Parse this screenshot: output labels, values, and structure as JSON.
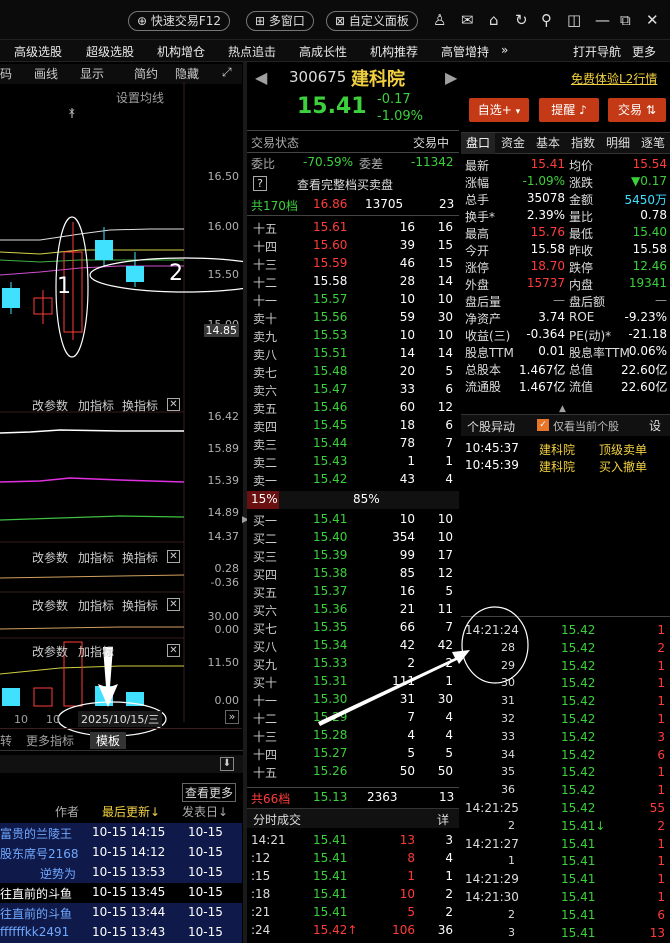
{
  "titlebar": {
    "quick_trade": "快速交易F12",
    "multi_window": "多窗口",
    "custom_panel": "自定义面板"
  },
  "menu": [
    "高级选股",
    "超级选股",
    "机构增仓",
    "热点追击",
    "高成长性",
    "机构推荐",
    "高管增持",
    "»",
    "打开导航",
    "更多"
  ],
  "chart": {
    "toolbar": [
      "码",
      "画线",
      "显示",
      "简约",
      "隐藏"
    ],
    "setting": "设置均线",
    "price_ticks": [
      "16.50",
      "16.00",
      "15.50",
      "15.00",
      "14.85"
    ],
    "annotations": [
      "1",
      "2"
    ],
    "panel1": {
      "labels": [
        "改参数",
        "加指标",
        "换指标"
      ],
      "ticks": [
        "16.42",
        "15.89",
        "15.39",
        "14.89",
        "14.37"
      ]
    },
    "panel2": {
      "labels": [
        "改参数",
        "加指标",
        "换指标"
      ],
      "ticks": [
        "0.28",
        "-0.36"
      ]
    },
    "panel3": {
      "labels": [
        "改参数",
        "加指标",
        "换指标"
      ],
      "ticks": [
        "30.00",
        "0.00"
      ]
    },
    "panel4": {
      "labels": [
        "改参数",
        "加指标"
      ],
      "ticks": [
        "11.50",
        "0.00"
      ]
    },
    "xlabels": [
      "10",
      "10"
    ],
    "date_label": "2025/10/15/三",
    "bottom_tabs": [
      "转",
      "更多指标",
      "模板"
    ]
  },
  "news": {
    "more": "查看更多",
    "headers": [
      "作者",
      "最后更新↓",
      "发表日↓"
    ],
    "rows": [
      [
        "富贵的兰陵王",
        "10-15 14:15",
        "10-15"
      ],
      [
        "股东席号2168",
        "10-15 14:12",
        "10-15"
      ],
      [
        "逆势为",
        "10-15 13:53",
        "10-15"
      ],
      [
        "往直前的斗鱼",
        "10-15 13:45",
        "10-15"
      ],
      [
        "往直前的斗鱼",
        "10-15 13:44",
        "10-15"
      ],
      [
        "ffffffkk2491",
        "10-15 13:43",
        "10-15"
      ]
    ]
  },
  "stock": {
    "code": "300675",
    "name": "建科院",
    "price": "15.41",
    "change": "-0.17",
    "pct": "-1.09%",
    "free_trial": "免费体验L2行情",
    "btn_watch": "自选+",
    "btn_alert": "提醒",
    "btn_trade": "交易"
  },
  "orderbook": {
    "status_label": "交易状态",
    "status_value": "交易中",
    "weibi_label": "委比",
    "weibi": "-70.59%",
    "weicha_label": "委差",
    "weicha": "-11342",
    "full_book": "查看完整档买卖盘",
    "sell_total": [
      "共170档",
      "16.86",
      "13705",
      "23"
    ],
    "sells": [
      [
        "十五",
        "15.61",
        "16",
        "16"
      ],
      [
        "十四",
        "15.60",
        "39",
        "15"
      ],
      [
        "十三",
        "15.59",
        "46",
        "15"
      ],
      [
        "十二",
        "15.58",
        "28",
        "14"
      ],
      [
        "十一",
        "15.57",
        "10",
        "10"
      ],
      [
        "卖十",
        "15.56",
        "59",
        "30"
      ],
      [
        "卖九",
        "15.53",
        "10",
        "10"
      ],
      [
        "卖八",
        "15.51",
        "14",
        "14"
      ],
      [
        "卖七",
        "15.48",
        "20",
        "5"
      ],
      [
        "卖六",
        "15.47",
        "33",
        "6"
      ],
      [
        "卖五",
        "15.46",
        "60",
        "12"
      ],
      [
        "卖四",
        "15.45",
        "18",
        "6"
      ],
      [
        "卖三",
        "15.44",
        "78",
        "7"
      ],
      [
        "卖二",
        "15.43",
        "1",
        "1"
      ],
      [
        "卖一",
        "15.42",
        "43",
        "4"
      ]
    ],
    "ratio": [
      "15%",
      "85%"
    ],
    "buys": [
      [
        "买一",
        "15.41",
        "10",
        "10"
      ],
      [
        "买二",
        "15.40",
        "354",
        "10"
      ],
      [
        "买三",
        "15.39",
        "99",
        "17"
      ],
      [
        "买四",
        "15.38",
        "85",
        "12"
      ],
      [
        "买五",
        "15.37",
        "16",
        "5"
      ],
      [
        "买六",
        "15.36",
        "21",
        "11"
      ],
      [
        "买七",
        "15.35",
        "66",
        "7"
      ],
      [
        "买八",
        "15.34",
        "42",
        "42"
      ],
      [
        "买九",
        "15.33",
        "2",
        "2"
      ],
      [
        "买十",
        "15.31",
        "111",
        "1"
      ],
      [
        "十一",
        "15.30",
        "31",
        "30"
      ],
      [
        "十二",
        "15.29",
        "7",
        "4"
      ],
      [
        "十三",
        "15.28",
        "4",
        "4"
      ],
      [
        "十四",
        "15.27",
        "5",
        "5"
      ],
      [
        "十五",
        "15.26",
        "50",
        "50"
      ]
    ],
    "buy_total": [
      "共66档",
      "15.13",
      "2363",
      "13"
    ]
  },
  "ticks_panel": {
    "title": "分时成交",
    "detail": "详",
    "rows": [
      [
        "14:21",
        "15.41",
        "13",
        "3"
      ],
      [
        ":12",
        "15.41",
        "8",
        "4"
      ],
      [
        ":15",
        "15.41",
        "1",
        "1"
      ],
      [
        ":18",
        "15.41",
        "10",
        "2"
      ],
      [
        ":21",
        "15.41",
        "5",
        "2"
      ],
      [
        ":24",
        "15.42↑",
        "106",
        "36"
      ]
    ]
  },
  "summary": {
    "tabs": [
      "盘口",
      "资金",
      "基本",
      "指数",
      "明细",
      "逐笔"
    ],
    "rows": [
      [
        "最新",
        "15.41",
        "均价",
        "15.54"
      ],
      [
        "涨幅",
        "-1.09%",
        "涨跌",
        "▼0.17"
      ],
      [
        "总手",
        "35078",
        "金额",
        "5450万"
      ],
      [
        "换手*",
        "2.39%",
        "量比",
        "0.78"
      ],
      [
        "最高",
        "15.76",
        "最低",
        "15.40"
      ],
      [
        "今开",
        "15.58",
        "昨收",
        "15.58"
      ],
      [
        "涨停",
        "18.70",
        "跌停",
        "12.46"
      ],
      [
        "外盘",
        "15737",
        "内盘",
        "19341"
      ],
      [
        "盘后量",
        "—",
        "盘后额",
        "—"
      ],
      [
        "净资产",
        "3.74",
        "ROE",
        "-9.23%"
      ],
      [
        "收益(三)",
        "-0.364",
        "PE(动)*",
        "-21.18"
      ],
      [
        "股息TTM",
        "0.01",
        "股息率TTM",
        "0.06%"
      ],
      [
        "总股本",
        "1.467亿",
        "总值",
        "22.60亿"
      ],
      [
        "流通股",
        "1.467亿",
        "流值",
        "22.60亿"
      ]
    ]
  },
  "abnormal": {
    "title": "个股异动",
    "checkbox": "仅看当前个股",
    "set": "设",
    "rows": [
      [
        "10:45:37",
        "建科院",
        "顶级卖单"
      ],
      [
        "10:45:39",
        "建科院",
        "买入撤单"
      ]
    ]
  },
  "trades": {
    "rows": [
      [
        "14:21:24",
        "15.42",
        "1"
      ],
      [
        "28",
        "15.42",
        "2"
      ],
      [
        "29",
        "15.42",
        "1"
      ],
      [
        "30",
        "15.42",
        "1"
      ],
      [
        "31",
        "15.42",
        "1"
      ],
      [
        "32",
        "15.42",
        "1"
      ],
      [
        "33",
        "15.42",
        "3"
      ],
      [
        "34",
        "15.42",
        "6"
      ],
      [
        "35",
        "15.42",
        "1"
      ],
      [
        "36",
        "15.42",
        "1"
      ],
      [
        "14:21:25",
        "15.42",
        "55"
      ],
      [
        "2",
        "15.41↓",
        "2"
      ],
      [
        "14:21:27",
        "15.41",
        "1"
      ],
      [
        "1",
        "15.41",
        "1"
      ],
      [
        "14:21:29",
        "15.41",
        "1"
      ],
      [
        "14:21:30",
        "15.41",
        "1"
      ],
      [
        "2",
        "15.41",
        "6"
      ],
      [
        "3",
        "15.41",
        "13"
      ]
    ]
  }
}
